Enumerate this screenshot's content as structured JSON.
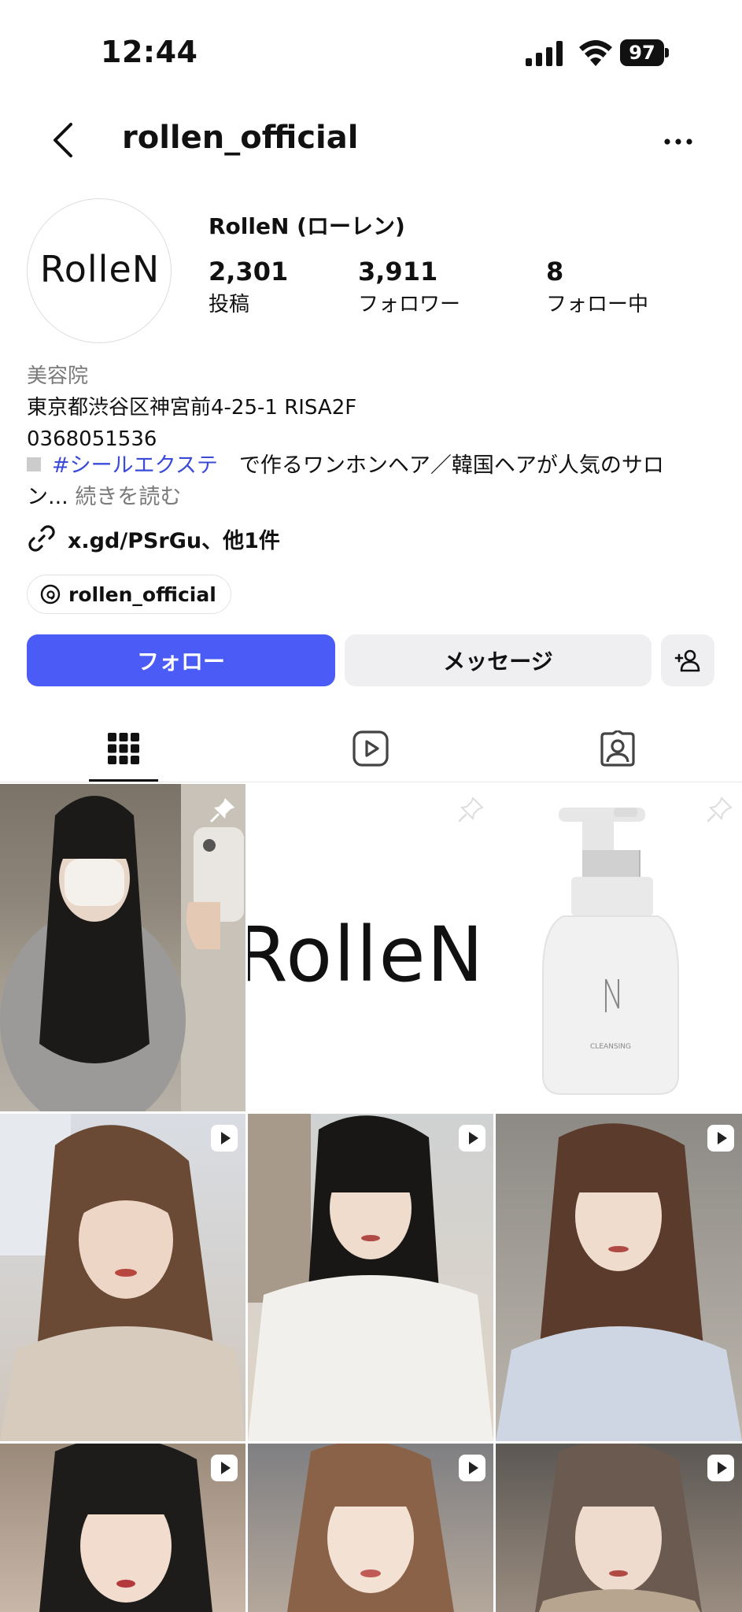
{
  "status_bar": {
    "time": "12:44",
    "battery": "97"
  },
  "header": {
    "username": "rollen_official"
  },
  "profile": {
    "avatar_text": "RolleN",
    "display_name": "RolleN (ローレン)",
    "stats": [
      {
        "value": "2,301",
        "label": "投稿"
      },
      {
        "value": "3,911",
        "label": "フォロワー"
      },
      {
        "value": "8",
        "label": "フォロー中"
      }
    ]
  },
  "bio": {
    "category": "美容院",
    "address": "東京都渋谷区神宮前4-25-1 RISA2F",
    "phone": "0368051536",
    "hashtag": "#シールエクステ",
    "description_rest": "　で作るワンホンヘア／韓国ヘアが人気のサロ",
    "description_line2": "ン...",
    "more_label": "続きを読む",
    "link": "x.gd/PSrGu、他1件",
    "threads_handle": "rollen_official"
  },
  "actions": {
    "follow_label": "フォロー",
    "message_label": "メッセージ"
  },
  "grid": {
    "posts": [
      {
        "kind": "pinned"
      },
      {
        "kind": "pinned",
        "logo_text": "RolleN"
      },
      {
        "kind": "pinned",
        "bottle_text": "CLEANSING"
      },
      {
        "kind": "reel"
      },
      {
        "kind": "reel"
      },
      {
        "kind": "reel"
      },
      {
        "kind": "reel"
      },
      {
        "kind": "reel"
      },
      {
        "kind": "reel"
      }
    ]
  },
  "colors": {
    "accent": "#4a5bf6",
    "hashtag": "#3b4bd8",
    "button_gray": "#efeff2",
    "muted_text": "#7a7a7a"
  }
}
